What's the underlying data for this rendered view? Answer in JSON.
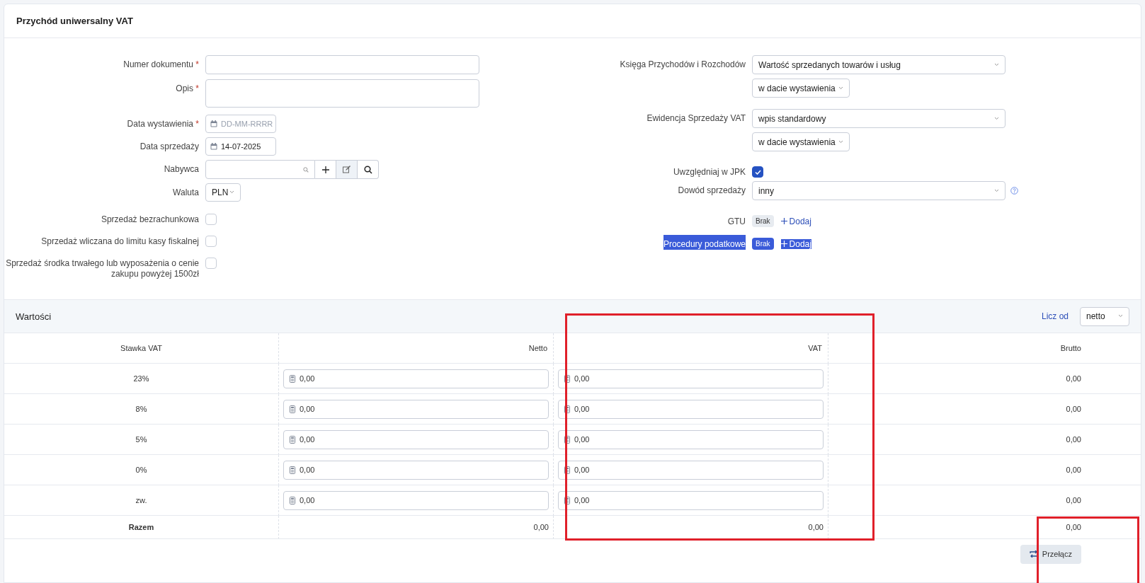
{
  "card": {
    "title": "Przychód uniwersalny VAT"
  },
  "left_fields": [
    {
      "kind": "text",
      "label": "Numer dokumentu",
      "required_mark": "*"
    },
    {
      "kind": "textarea",
      "label": "Opis",
      "required_mark": "*"
    },
    {
      "kind": "date",
      "label": "Data wystawienia",
      "required_mark": "*",
      "placeholder": "DD-MM-RRRR"
    },
    {
      "kind": "date",
      "label": "Data sprzedaży",
      "value": "14-07-2025"
    },
    {
      "kind": "buyer",
      "label": "Nabywca"
    },
    {
      "kind": "select",
      "label": "Waluta",
      "value": "PLN"
    },
    {
      "kind": "checkbox",
      "label": "Sprzedaż bezrachunkowa",
      "checked": false
    },
    {
      "kind": "checkbox",
      "label": "Sprzedaż wliczana do limitu kasy fiskalnej",
      "checked": false
    },
    {
      "kind": "checkbox",
      "label": "Sprzedaż środka trwałego lub wyposażenia o cenie zakupu powyżej 1500zł",
      "checked": false
    }
  ],
  "right_fields": [
    {
      "kind": "select_pair",
      "label": "Księga Przychodów i Rozchodów",
      "value": "Wartość sprzedanych towarów i usług",
      "second_value": "w dacie wystawienia"
    },
    {
      "kind": "select_pair",
      "label": "Ewidencja Sprzedaży VAT",
      "value": "wpis standardowy",
      "second_value": "w dacie wystawienia"
    },
    {
      "kind": "checkbox",
      "label": "Uwzględniaj w JPK",
      "checked": true
    },
    {
      "kind": "select_help",
      "label": "Dowód sprzedaży",
      "value": "inny"
    },
    {
      "kind": "tags",
      "label": "GTU",
      "tag": "Brak",
      "add": "Dodaj",
      "text_selected": false
    },
    {
      "kind": "tags",
      "label": "Procedury podatkowe",
      "tag": "Brak",
      "add": "Dodaj",
      "text_selected": true
    }
  ],
  "values": {
    "title": "Wartości",
    "count_from_label": "Licz od",
    "count_from_value": "netto",
    "columns": [
      "Stawka VAT",
      "Netto",
      "VAT",
      "Brutto"
    ],
    "rows": [
      {
        "rate": "23%",
        "netto": "0,00",
        "vat": "0,00",
        "brutto": "0,00"
      },
      {
        "rate": "8%",
        "netto": "0,00",
        "vat": "0,00",
        "brutto": "0,00"
      },
      {
        "rate": "5%",
        "netto": "0,00",
        "vat": "0,00",
        "brutto": "0,00"
      },
      {
        "rate": "0%",
        "netto": "0,00",
        "vat": "0,00",
        "brutto": "0,00"
      },
      {
        "rate": "zw.",
        "netto": "0,00",
        "vat": "0,00",
        "brutto": "0,00"
      }
    ],
    "total": {
      "label": "Razem",
      "netto": "0,00",
      "vat": "0,00",
      "brutto": "0,00"
    },
    "switch_button": "Przełącz"
  },
  "annotations": [
    {
      "kind": "frame",
      "color": "#e0202a"
    },
    {
      "kind": "frame",
      "color": "#e0202a"
    }
  ]
}
